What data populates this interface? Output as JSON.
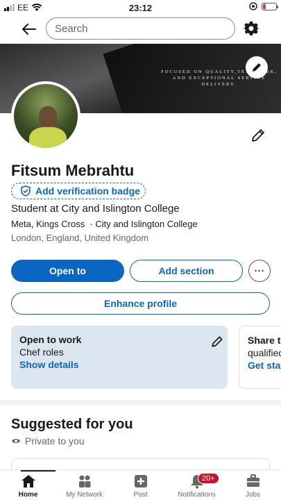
{
  "status_bar": {
    "carrier": "EE",
    "time": "23:12",
    "battery_level": 0.15
  },
  "search": {
    "placeholder": "Search"
  },
  "cover": {
    "text": "FOCUSED ON QUALITY,TEAMWORK, AND EXCEPTIONAL SERVICE DELIVERY."
  },
  "profile": {
    "name": "Fitsum Mebrahtu",
    "verify_label": "Add verification badge",
    "headline": "Student at City and Islington College",
    "company": "Meta, Kings Cross  · City and Islington College",
    "location": "London, England, United Kingdom"
  },
  "actions": {
    "open_to": "Open to",
    "add_section": "Add section",
    "more": "···",
    "enhance": "Enhance profile"
  },
  "open_to_work": {
    "title": "Open to work",
    "role": "Chef roles",
    "link": "Show details"
  },
  "share_card": {
    "title": "Share th",
    "body": "qualified",
    "link": "Get star"
  },
  "suggested": {
    "title": "Suggested for you",
    "privacy": "Private to you"
  },
  "tabs": [
    {
      "label": "Home",
      "icon": "home-icon",
      "active": true
    },
    {
      "label": "My Network",
      "icon": "network-icon"
    },
    {
      "label": "Post",
      "icon": "post-icon"
    },
    {
      "label": "Notifications",
      "icon": "bell-icon",
      "badge": "20+"
    },
    {
      "label": "Jobs",
      "icon": "briefcase-icon"
    }
  ],
  "colors": {
    "brand": "#0a66c2",
    "open_card_bg": "#dce6f1",
    "badge": "#cb112d"
  }
}
